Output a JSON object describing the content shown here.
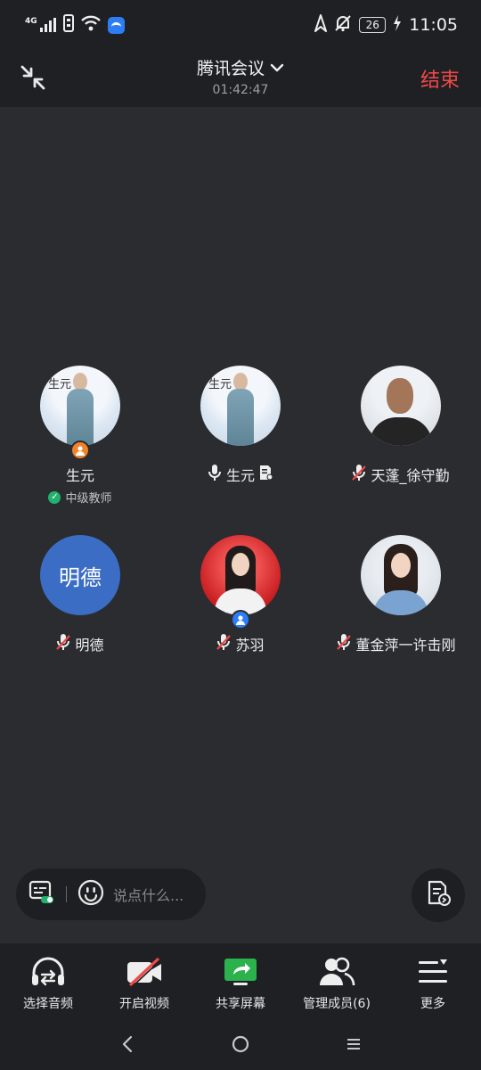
{
  "status_bar": {
    "network_label": "4G",
    "battery": "26",
    "time": "11:05",
    "icons": [
      "signal-icon",
      "sim-icon",
      "wifi-icon",
      "app-badge-icon",
      "location-icon",
      "mute-bell-icon",
      "battery-icon",
      "charging-icon"
    ]
  },
  "header": {
    "title": "腾讯会议",
    "elapsed": "01:42:47",
    "end_label": "结束"
  },
  "participants": [
    {
      "name": "生元",
      "subtitle": "中级教师",
      "avatar": "photo",
      "host_badge": "orange",
      "mic": "none"
    },
    {
      "name": "生元",
      "avatar": "photo",
      "mic": "on",
      "extra_icon": "document-icon"
    },
    {
      "name": "天蓬_徐守勤",
      "avatar": "photo",
      "mic": "muted"
    },
    {
      "name": "明德",
      "avatar_text": "明德",
      "avatar": "initials",
      "mic": "muted"
    },
    {
      "name": "苏羽",
      "avatar": "photo",
      "host_badge": "blue",
      "mic": "muted"
    },
    {
      "name": "董金萍一许击刚",
      "avatar": "photo",
      "mic": "muted"
    }
  ],
  "chat": {
    "placeholder": "说点什么..."
  },
  "toolbar": {
    "audio": "选择音频",
    "video": "开启视频",
    "share": "共享屏幕",
    "members": "管理成员(6)",
    "more": "更多"
  },
  "colors": {
    "background": "#2a2c30",
    "bar": "#1f2023",
    "end": "#f24848",
    "accent_blue": "#2c7df6",
    "share_green": "#2bb24c"
  }
}
